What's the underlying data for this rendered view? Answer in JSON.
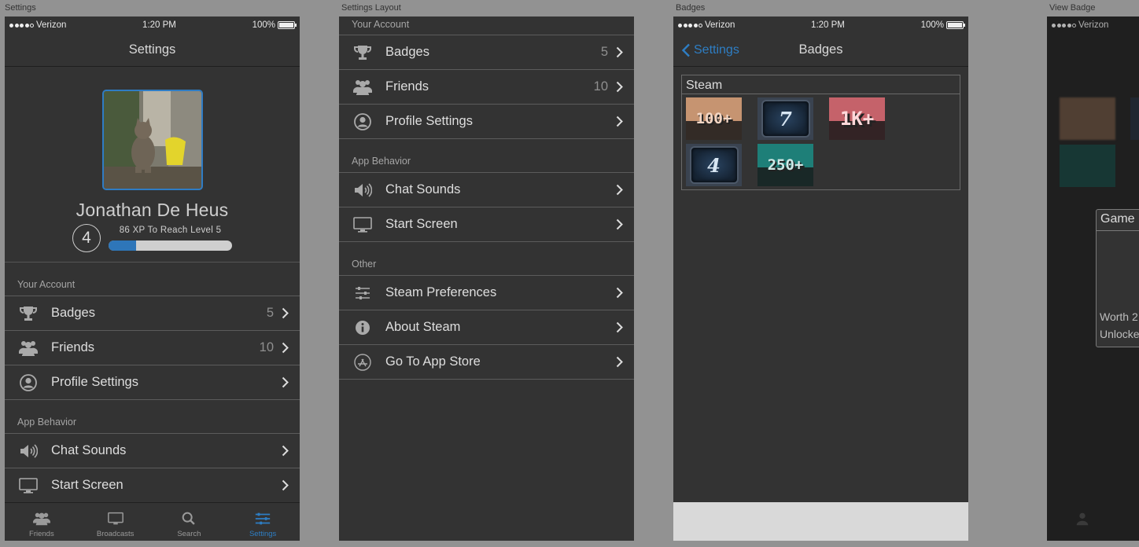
{
  "artboards": {
    "settings": "Settings",
    "settings_layout": "Settings Layout",
    "badges": "Badges",
    "view_badge": "View Badge"
  },
  "status": {
    "carrier": "Verizon",
    "time": "1:20 PM",
    "battery": "100%"
  },
  "settings": {
    "title": "Settings",
    "user_name": "Jonathan De Heus",
    "level": "4",
    "xp_text": "86 XP To Reach Level 5",
    "xp_progress_percent": 22,
    "sections": [
      {
        "header": "Your Account",
        "rows": [
          {
            "label": "Badges",
            "count": "5",
            "icon": "trophy-icon"
          },
          {
            "label": "Friends",
            "count": "10",
            "icon": "friends-icon"
          },
          {
            "label": "Profile Settings",
            "count": "",
            "icon": "user-circle-icon"
          }
        ]
      },
      {
        "header": "App Behavior",
        "rows": [
          {
            "label": "Chat Sounds",
            "count": "",
            "icon": "speaker-icon"
          },
          {
            "label": "Start Screen",
            "count": "",
            "icon": "monitor-icon"
          }
        ]
      },
      {
        "header": "Other",
        "rows": [
          {
            "label": "Steam Preferences",
            "count": "",
            "icon": "sliders-icon"
          },
          {
            "label": "About Steam",
            "count": "",
            "icon": "info-icon"
          },
          {
            "label": "Go To App Store",
            "count": "",
            "icon": "app-store-icon"
          }
        ]
      }
    ]
  },
  "tabbar": [
    {
      "label": "Friends",
      "icon": "friends-icon",
      "active": false
    },
    {
      "label": "Broadcasts",
      "icon": "monitor-icon",
      "active": false
    },
    {
      "label": "Search",
      "icon": "search-icon",
      "active": false
    },
    {
      "label": "Settings",
      "icon": "sliders-icon",
      "active": true
    }
  ],
  "badges": {
    "back_label": "Settings",
    "title": "Badges",
    "group_title": "Steam",
    "items": [
      "100+",
      "7",
      "1K+",
      "4",
      "250+"
    ]
  },
  "view_badge": {
    "carrier": "Verizon",
    "card_title": "Game I",
    "worth_text": "Worth 2",
    "unlocked_text": "Unlocke"
  },
  "colors": {
    "accent": "#2e7ec4",
    "background": "#333333",
    "canvas": "#929292"
  }
}
